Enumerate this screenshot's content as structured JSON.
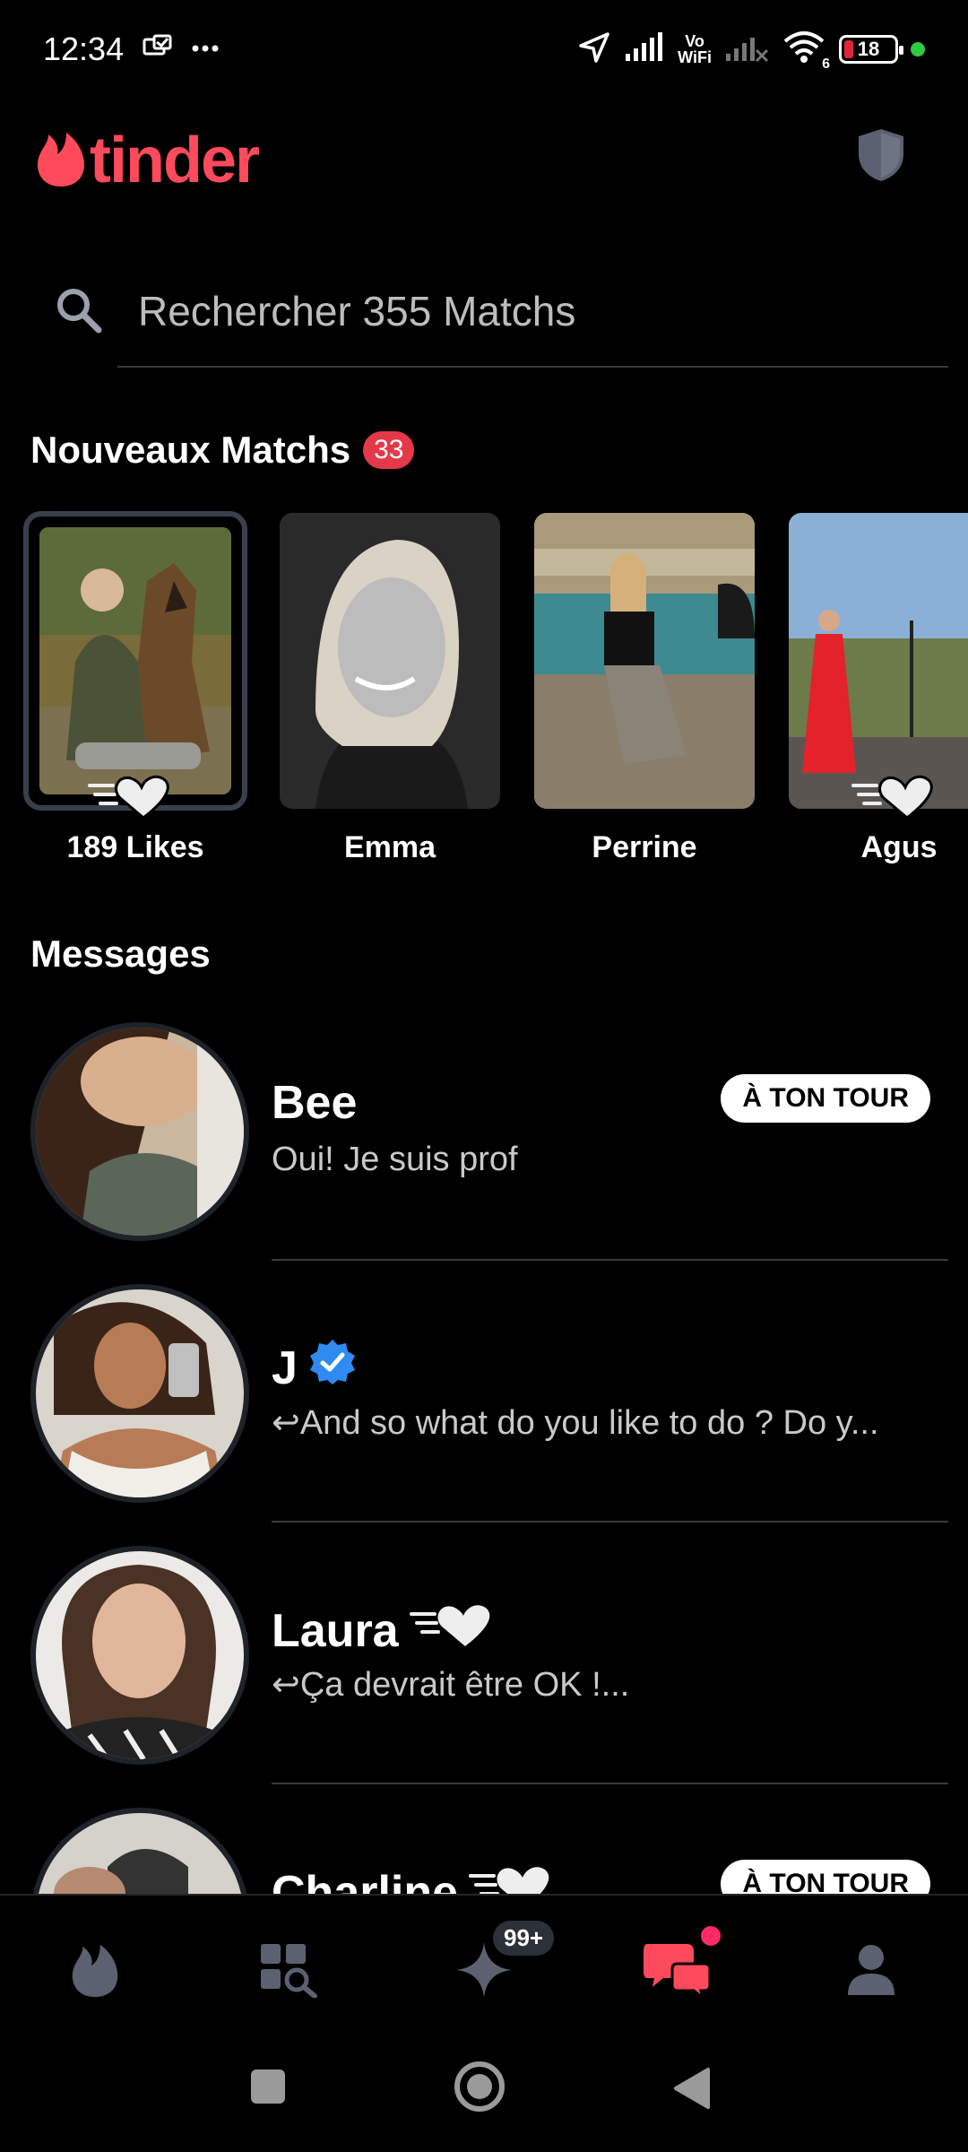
{
  "status_bar": {
    "time": "12:34",
    "vowifi_top": "Vo",
    "vowifi_bottom": "WiFi",
    "wifi_sub": "6",
    "battery": "18"
  },
  "header": {
    "logo_text": "tinder"
  },
  "search": {
    "placeholder": "Rechercher 355 Matchs"
  },
  "new_matches": {
    "title": "Nouveaux Matchs",
    "count": "33",
    "items": [
      {
        "name": "189 Likes"
      },
      {
        "name": "Emma"
      },
      {
        "name": "Perrine"
      },
      {
        "name": "Agus"
      }
    ]
  },
  "messages": {
    "title": "Messages",
    "items": [
      {
        "name": "Bee",
        "preview": "Oui! Je suis prof",
        "badge": "À TON TOUR"
      },
      {
        "name": "J",
        "preview": "↩And so what do you like to do ? Do y..."
      },
      {
        "name": "Laura",
        "preview": "↩Ça devrait être OK !..."
      },
      {
        "name": "Charline",
        "badge": "À TON TOUR"
      }
    ]
  },
  "bottom_nav": {
    "gold_badge": "99+"
  },
  "colors": {
    "brand": "#fd4a5c",
    "badge": "#e5394a",
    "nav_active": "#fd4a5c",
    "nav_inactive": "#5b6170",
    "background": "#000000"
  }
}
